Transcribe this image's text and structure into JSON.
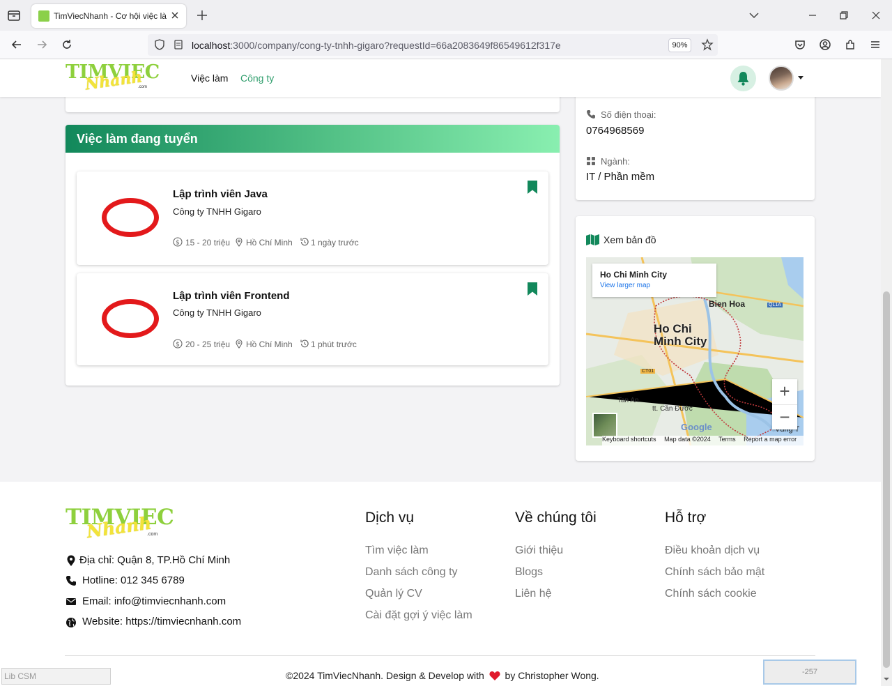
{
  "browser": {
    "tab_title": "TimViecNhanh - Cơ hội việc làm",
    "url_host": "localhost",
    "url_rest": ":3000/company/cong-ty-tnhh-gigaro?requestId=66a2083649f86549612f317e",
    "zoom": "90%"
  },
  "header": {
    "logo": {
      "top": "TIMVIEC",
      "script": "Nhanh",
      "suffix": ".com"
    },
    "nav": [
      {
        "label": "Việc làm"
      },
      {
        "label": "Công ty"
      }
    ]
  },
  "jobs_section": {
    "title": "Việc làm đang tuyển",
    "jobs": [
      {
        "title": "Lập trình viên Java",
        "company": "Công ty TNHH Gigaro",
        "salary": "15 - 20 triệu",
        "location": "Hồ Chí Minh",
        "posted": "1 ngày trước"
      },
      {
        "title": "Lập trình viên Frontend",
        "company": "Công ty TNHH Gigaro",
        "salary": "20 - 25 triệu",
        "location": "Hồ Chí Minh",
        "posted": "1 phút trước"
      }
    ]
  },
  "company_info": {
    "phone_label": "Số điện thoại:",
    "phone_value": "0764968569",
    "industry_label": "Ngành:",
    "industry_value": "IT / Phần mềm"
  },
  "map": {
    "title": "Xem bản đồ",
    "popup_title": "Ho Chi Minh City",
    "popup_link": "View larger map",
    "labels": {
      "city": "Ho Chi",
      "city2": "Minh City",
      "bien_hoa": "Bien Hoa",
      "tan_an": "Tan An",
      "can_duoc": "tt. Cần Đước",
      "vung_tau": "Vũng T",
      "ql1a": "QL1A",
      "ct01": "CT01",
      "google": "Google"
    },
    "footer": [
      "Keyboard shortcuts",
      "Map data ©2024",
      "Terms",
      "Report a map error"
    ]
  },
  "footer": {
    "logo": {
      "top": "TIMVIEC",
      "script": "Nhanh",
      "suffix": ".com"
    },
    "contact": [
      {
        "icon": "location-pin-icon",
        "text": "Địa chỉ: Quận 8, TP.Hồ Chí Minh"
      },
      {
        "icon": "phone-icon",
        "text": "Hotline: 012 345 6789"
      },
      {
        "icon": "envelope-icon",
        "text": "Email: info@timviecnhanh.com"
      },
      {
        "icon": "globe-icon",
        "text": "Website: https://timviecnhanh.com"
      }
    ],
    "columns": [
      {
        "title": "Dịch vụ",
        "links": [
          "Tìm việc làm",
          "Danh sách công ty",
          "Quản lý CV",
          "Cài đặt gợi ý việc làm"
        ]
      },
      {
        "title": "Về chúng tôi",
        "links": [
          "Giới thiệu",
          "Blogs",
          "Liên hệ"
        ]
      },
      {
        "title": "Hỗ trợ",
        "links": [
          "Điều khoản dịch vụ",
          "Chính sách bảo mật",
          "Chính sách cookie"
        ]
      }
    ],
    "copyright_before": "©2024 TimViecNhanh. Design & Develop with",
    "copyright_after": "by Christopher Wong."
  },
  "overlays": {
    "left": "Lib CSM",
    "right": "-257"
  },
  "colors": {
    "brand_green": "#12885b",
    "accent_green": "#2f9e6c",
    "logo_green": "#8ed03d",
    "logo_yellow": "#f2e33a",
    "heart_red": "#e0192b"
  }
}
